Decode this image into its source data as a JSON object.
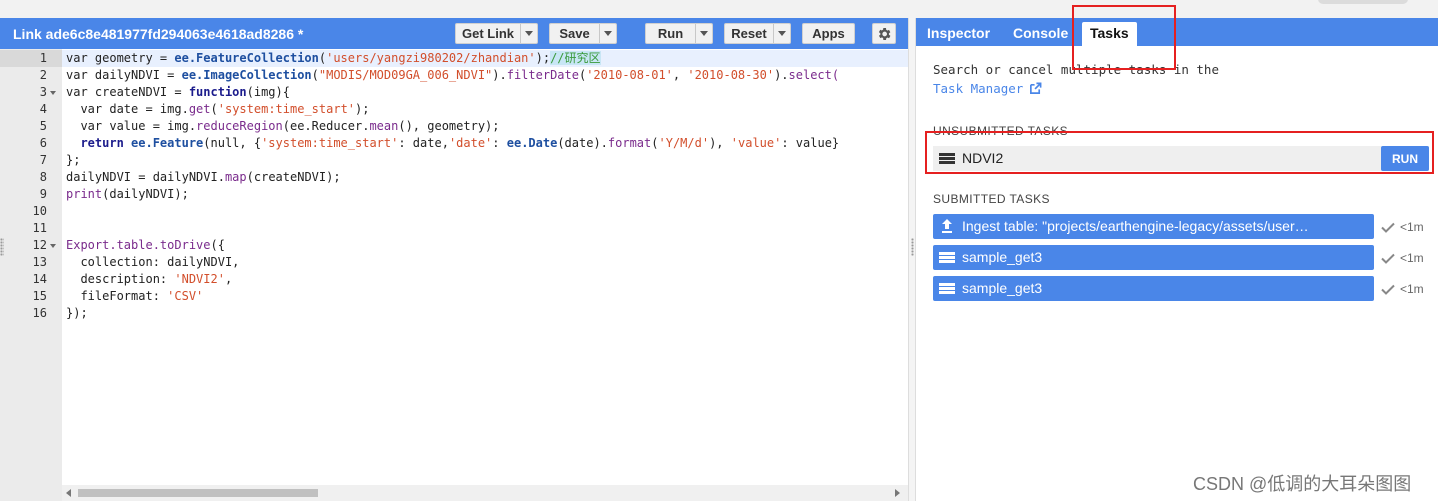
{
  "editor": {
    "title": "Link ade6c8e481977fd294063e4618ad8286 *",
    "buttons": {
      "get_link": "Get Link",
      "save": "Save",
      "run": "Run",
      "reset": "Reset",
      "apps": "Apps"
    },
    "line_numbers": [
      "1",
      "2",
      "3",
      "4",
      "5",
      "6",
      "7",
      "8",
      "9",
      "10",
      "11",
      "12",
      "13",
      "14",
      "15",
      "16"
    ],
    "code": {
      "l1a": "var geometry = ",
      "l1b": "ee.FeatureCollection",
      "l1c": "(",
      "l1d": "'users/yangzi980202/zhandian'",
      "l1e": ");",
      "l1f": "//研究区",
      "l2a": "var dailyNDVI = ",
      "l2b": "ee.ImageCollection",
      "l2c": "(",
      "l2d": "\"MODIS/MOD09GA_006_NDVI\"",
      "l2e": ").",
      "l2f": "filterDate",
      "l2g": "(",
      "l2h": "'2010-08-01'",
      "l2i": ", ",
      "l2j": "'2010-08-30'",
      "l2k": ").",
      "l2l": "select(",
      "l3a": "var createNDVI = ",
      "l3b": "function",
      "l3c": "(img){",
      "l4a": "  var date = img.",
      "l4b": "get",
      "l4c": "(",
      "l4d": "'system:time_start'",
      "l4e": ");",
      "l5a": "  var value = img.",
      "l5b": "reduceRegion",
      "l5c": "(ee.Reducer.",
      "l5d": "mean",
      "l5e": "(), geometry);",
      "l6a": "  return ",
      "l6b": "ee.Feature",
      "l6c": "(null, {",
      "l6d": "'system:time_start'",
      "l6e": ": date,",
      "l6f": "'date'",
      "l6g": ": ",
      "l6h": "ee.Date",
      "l6i": "(date).",
      "l6j": "format",
      "l6k": "(",
      "l6l": "'Y/M/d'",
      "l6m": "), ",
      "l6n": "'value'",
      "l6o": ": value}",
      "l7": "};",
      "l8a": "dailyNDVI = dailyNDVI.",
      "l8b": "map",
      "l8c": "(createNDVI);",
      "l9a": "print",
      "l9b": "(dailyNDVI);",
      "l12a": "Export.table.toDrive",
      "l12b": "({",
      "l13": "  collection: dailyNDVI,",
      "l14a": "  description: ",
      "l14b": "'NDVI2'",
      "l14c": ",",
      "l15a": "  fileFormat: ",
      "l15b": "'CSV'",
      "l16": "});"
    }
  },
  "panel": {
    "tabs": [
      "Inspector",
      "Console",
      "Tasks"
    ],
    "search_text": "Search or cancel multiple tasks in the",
    "task_manager_link": "Task Manager",
    "unsubmitted_header": "UNSUBMITTED TASKS",
    "unsubmitted": [
      {
        "name": "NDVI2",
        "action": "RUN"
      }
    ],
    "submitted_header": "SUBMITTED TASKS",
    "submitted": [
      {
        "name": "Ingest table: \"projects/earthengine-legacy/assets/user…",
        "status": "<1m",
        "icon": "upload-icon"
      },
      {
        "name": "sample_get3",
        "status": "<1m",
        "icon": "table-icon"
      },
      {
        "name": "sample_get3",
        "status": "<1m",
        "icon": "table-icon"
      }
    ]
  },
  "watermark": "CSDN @低调的大耳朵图图",
  "colors": {
    "accent": "#4a86e8",
    "highlight": "#e52020"
  }
}
